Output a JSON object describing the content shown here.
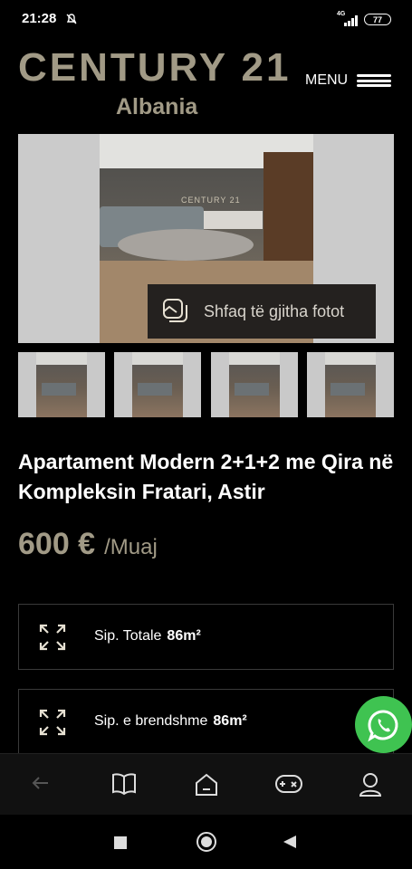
{
  "status_bar": {
    "time": "21:28",
    "network": "4G",
    "battery": "77",
    "icons": [
      "alarm-off-icon",
      "signal-icon",
      "battery-icon"
    ]
  },
  "header": {
    "logo_main": "CENTURY 21",
    "logo_sub": "Albania",
    "menu_label": "MENU",
    "brand_color": "#a19a86"
  },
  "gallery": {
    "watermark": "CENTURY 21",
    "show_all_label": "Shfaq të gjitha fotot",
    "thumbnail_count": 4
  },
  "listing": {
    "title": "Apartament Modern 2+1+2 me Qira në Kompleksin Fratari, Astir",
    "price": "600 €",
    "period": "/Muaj"
  },
  "areas": [
    {
      "label": "Sip. Totale",
      "value": "86m²",
      "icon": "expand-icon"
    },
    {
      "label": "Sip. e brendshme",
      "value": "86m²",
      "icon": "expand-icon"
    }
  ],
  "whatsapp": {
    "icon": "whatsapp-icon",
    "color": "#3fc351"
  },
  "browser_bar": {
    "icons": [
      "back-arrow-icon",
      "book-icon",
      "home-icon",
      "gamepad-icon",
      "profile-icon"
    ]
  },
  "system_nav": {
    "icons": [
      "recents-icon",
      "home-circle-icon",
      "back-triangle-icon"
    ]
  }
}
